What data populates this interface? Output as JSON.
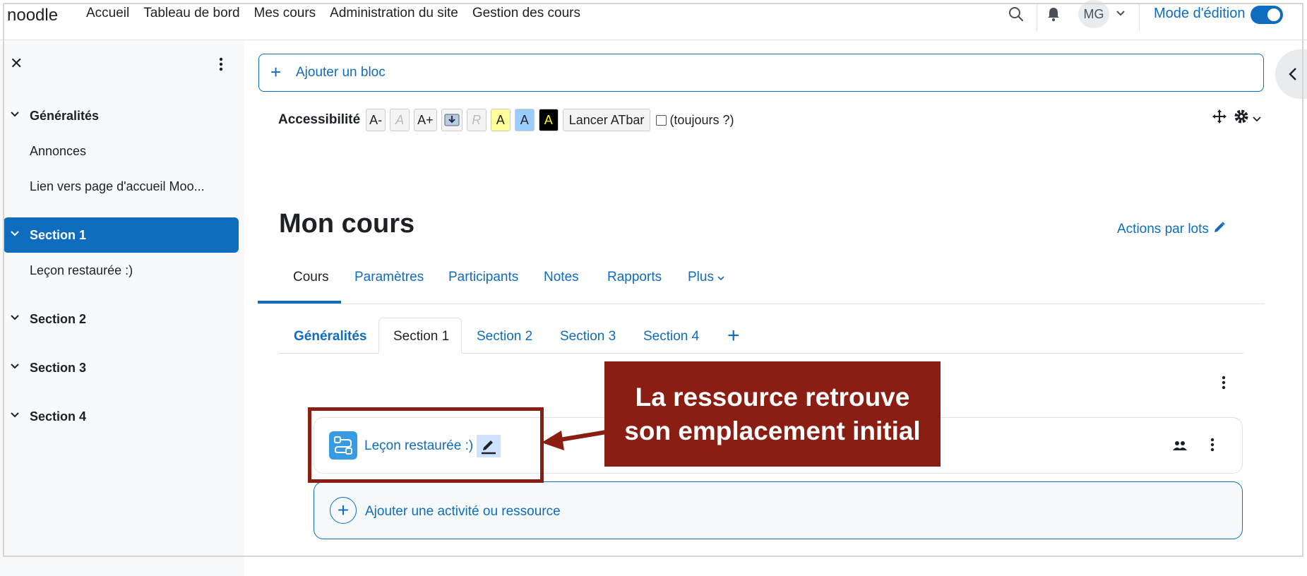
{
  "navbar": {
    "brand": "noodle",
    "links": [
      "Accueil",
      "Tableau de bord",
      "Mes cours",
      "Administration du site",
      "Gestion des cours"
    ],
    "avatar_initials": "MG",
    "edit_mode_label": "Mode d'édition",
    "edit_mode_on": true
  },
  "drawer": {
    "items": [
      {
        "label": "Généralités",
        "type": "section"
      },
      {
        "label": "Annonces",
        "type": "activity"
      },
      {
        "label": "Lien vers page d'accueil Moo...",
        "type": "activity"
      },
      {
        "label": "Section 1",
        "type": "section",
        "active": true
      },
      {
        "label": "Leçon restaurée :)",
        "type": "activity"
      },
      {
        "label": "Section 2",
        "type": "section"
      },
      {
        "label": "Section 3",
        "type": "section"
      },
      {
        "label": "Section 4",
        "type": "section"
      }
    ]
  },
  "blocks": {
    "add_block_label": "Ajouter un bloc"
  },
  "accessibility": {
    "title": "Accessibilité",
    "buttons": [
      "A-",
      "A",
      "A+",
      "R",
      "A",
      "A",
      "A"
    ],
    "launch_label": "Lancer ATbar",
    "always_label": "(toujours ?)"
  },
  "course": {
    "title": "Mon cours",
    "bulk_actions_label": "Actions par lots",
    "tabs": [
      "Cours",
      "Paramètres",
      "Participants",
      "Notes",
      "Rapports",
      "Plus"
    ],
    "active_tab": "Cours",
    "section_tabs": [
      "Généralités",
      "Section 1",
      "Section 2",
      "Section 3",
      "Section 4"
    ],
    "active_section_tab": "Section 1"
  },
  "activity": {
    "name": "Leçon restaurée :)"
  },
  "add_activity_label": "Ajouter une activité ou ressource",
  "annotation": {
    "line1": "La ressource retrouve",
    "line2": "son emplacement initial"
  },
  "colors": {
    "accent": "#0f6cbf",
    "annotation": "#8b1e12"
  }
}
